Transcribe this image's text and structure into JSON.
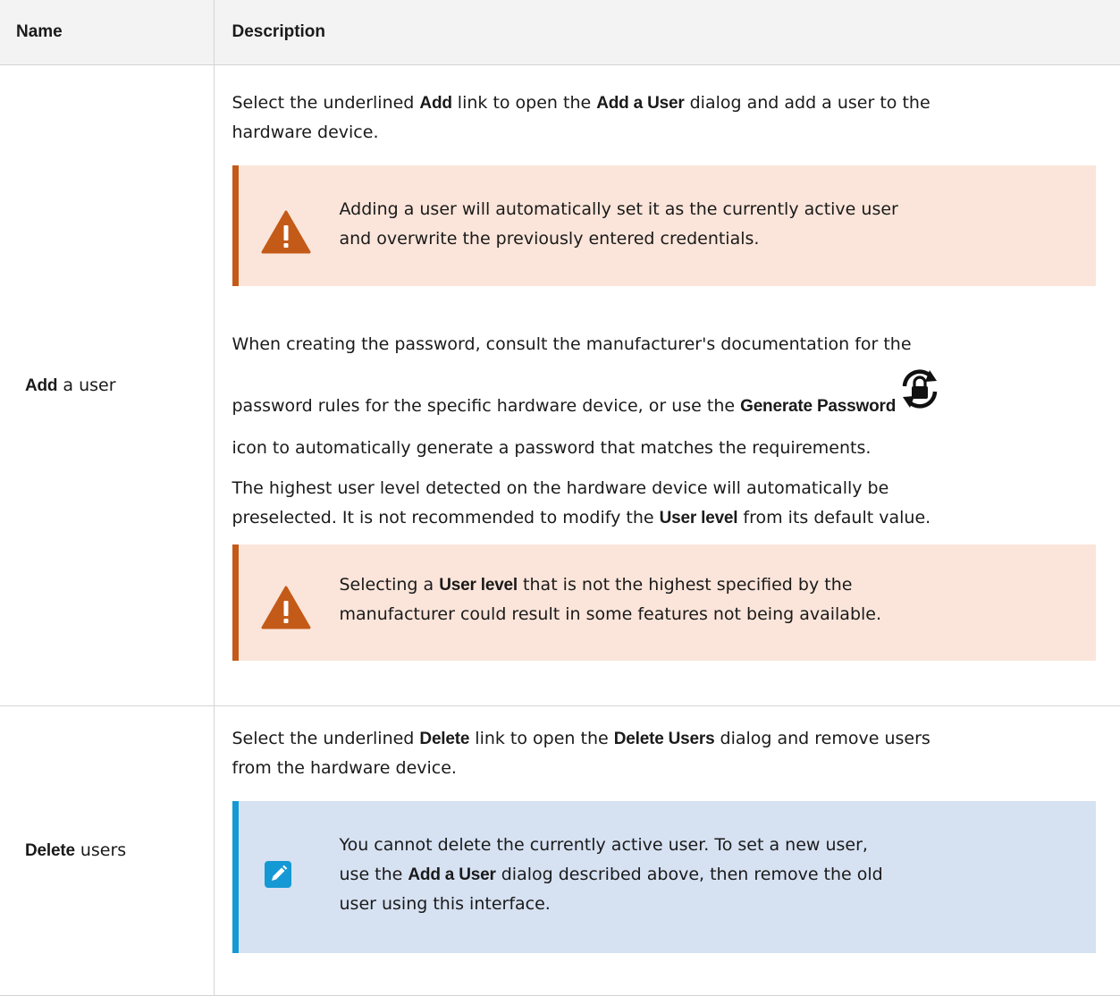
{
  "table": {
    "headers": {
      "name": "Name",
      "description": "Description"
    },
    "row1": {
      "name_bold": "Add",
      "name_rest": " a user",
      "p1": {
        "t1": "Select the underlined ",
        "b1": "Add",
        "t2": " link to open the ",
        "b2": "Add a User",
        "t3": " dialog and add a user to the",
        "t4": "hardware device."
      },
      "warning1": {
        "line1": "Adding a user will automatically set it as the currently active user",
        "line2": "and overwrite the previously entered credentials."
      },
      "p2": {
        "line1": "When creating the password, consult the manufacturer's documentation for the",
        "t1": "password rules for the specific hardware device, or use the ",
        "b1": "Generate Password",
        "line3": "icon to automatically generate a password that matches the requirements."
      },
      "p3": {
        "line1": "The highest user level detected on the hardware device will automatically be",
        "t1": "preselected. It is not recommended to modify the ",
        "b1": "User level",
        "t2": " from its default value."
      },
      "warning2": {
        "t1": "Selecting a ",
        "b1": "User level",
        "t2": " that is not the highest specified by the",
        "line2": "manufacturer could result in some features not being available."
      }
    },
    "row2": {
      "name_bold": "Delete",
      "name_rest": " users",
      "p1": {
        "t1": "Select the underlined ",
        "b1": "Delete",
        "t2": " link to open the ",
        "b2": "Delete Users",
        "t3": " dialog and remove users",
        "t4": "from the hardware device."
      },
      "note": {
        "line1": "You cannot delete the currently active user. To set a new user,",
        "t1": "use the ",
        "b1": "Add a User",
        "t2": " dialog described above, then remove the old",
        "line3": "user using this interface."
      }
    }
  },
  "colors": {
    "warning_accent": "#c45a18",
    "warning_bg": "#fbe5da",
    "note_accent": "#1599d5",
    "note_bg": "#d6e1f2",
    "header_bg": "#f3f3f3"
  },
  "icons": {
    "warning": "warning-triangle-icon",
    "generate_password": "generate-password-icon",
    "note": "pencil-note-icon"
  }
}
